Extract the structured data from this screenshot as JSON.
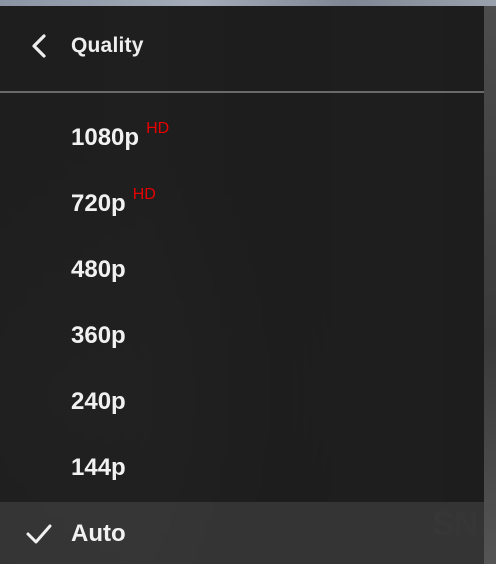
{
  "menu": {
    "title": "Quality",
    "back_icon": "chevron-left-icon",
    "check_icon": "checkmark-icon",
    "options": [
      {
        "label": "1080p",
        "badge": "HD"
      },
      {
        "label": "720p",
        "badge": "HD"
      },
      {
        "label": "480p",
        "badge": ""
      },
      {
        "label": "360p",
        "badge": ""
      },
      {
        "label": "240p",
        "badge": ""
      },
      {
        "label": "144p",
        "badge": ""
      },
      {
        "label": "Auto",
        "badge": "",
        "selected": true
      }
    ]
  },
  "colors": {
    "panel_bg": "#1c1c1c",
    "text": "#eeeeee",
    "hd_badge": "#e60000",
    "divider": "#6a6a6a"
  }
}
